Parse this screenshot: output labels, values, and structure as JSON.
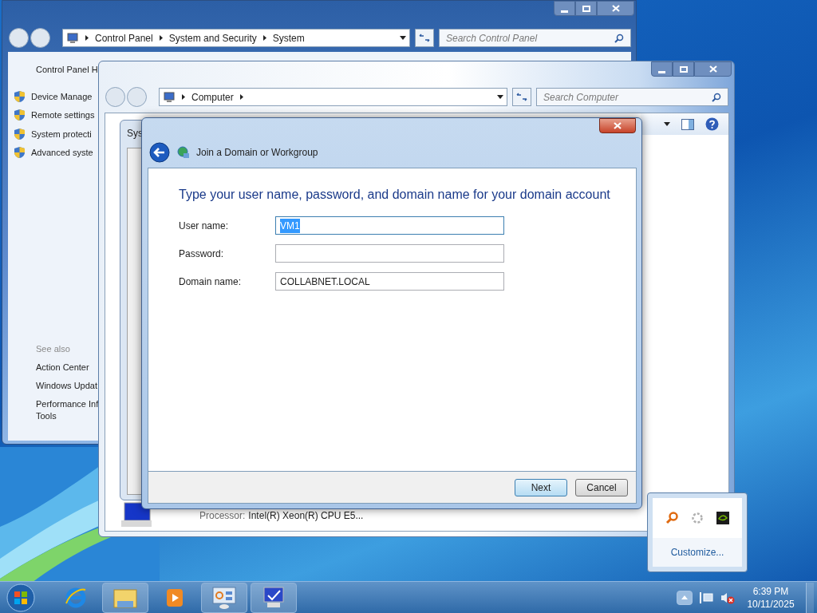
{
  "control_panel": {
    "breadcrumb": [
      "Control Panel",
      "System and Security",
      "System"
    ],
    "search_placeholder": "Search Control Panel",
    "home_link": "Control Panel H",
    "tasks": [
      "Device Manage",
      "Remote settings",
      "System protecti",
      "Advanced syste"
    ],
    "see_also_heading": "See also",
    "see_also": [
      "Action Center",
      "Windows Updat",
      "Performance Inf",
      "Tools"
    ]
  },
  "computer": {
    "breadcrumb": [
      "Computer"
    ],
    "search_placeholder": "Search Computer",
    "processor_label": "Processor:",
    "processor_value": "Intel(R) Xeon(R) CPU E5..."
  },
  "system_properties": {
    "title": "Sys"
  },
  "dialog": {
    "title": "Join a Domain or Workgroup",
    "heading": "Type your user name, password, and domain name for your domain account",
    "fields": [
      {
        "label": "User name:",
        "value": "VM1",
        "selected": true
      },
      {
        "label": "Password:",
        "selected": false
      },
      {
        "label": "Domain name:",
        "value": "COLLABNET.LOCAL",
        "selected": false
      }
    ],
    "buttons": [
      {
        "label": "Next",
        "default": true
      },
      {
        "label": "Cancel",
        "default": false
      }
    ]
  },
  "tray_popup": {
    "link": "Customize..."
  },
  "taskbar": {
    "time": "6:39 PM",
    "date": "10/11/2025"
  }
}
